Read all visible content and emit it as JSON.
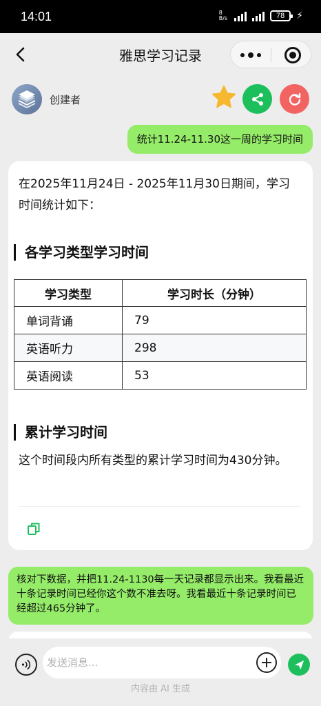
{
  "status": {
    "time": "14:01",
    "speed": "8",
    "speed_unit": "B/s",
    "battery": "78"
  },
  "nav": {
    "title": "雅思学习记录"
  },
  "creator": {
    "label": "创建者"
  },
  "colors": {
    "user_bubble": "#95ec69",
    "share": "#1dbf5c",
    "refresh": "#f26462",
    "star": "#f5b82e"
  },
  "messages": {
    "user_query": "统计11.24-11.30这一周的学习时间",
    "reply": {
      "intro": "在2025年11月24日 - 2025年11月30日期间，学习时间统计如下：",
      "section1_title": "各学习类型学习时间",
      "table": {
        "headers": [
          "学习类型",
          "学习时长（分钟）"
        ],
        "rows": [
          [
            "单词背诵",
            "79"
          ],
          [
            "英语听力",
            "298"
          ],
          [
            "英语阅读",
            "53"
          ]
        ]
      },
      "section2_title": "累计学习时间",
      "summary": "这个时间段内所有类型的累计学习时间为430分钟。"
    },
    "user_followup": "核对下数据，并把11.24-1130每一天记录都显示出来。我看最近十条记录时间已经你这个数不准去呀。我看最近十条记录时间已经超过465分钟了。"
  },
  "input": {
    "placeholder": "发送消息..."
  },
  "footer": {
    "note": "内容由 AI 生成"
  },
  "icons": [
    "back-arrow-icon",
    "more-icon",
    "target-icon",
    "layers-icon",
    "star-icon",
    "share-icon",
    "refresh-icon",
    "copy-icon",
    "voice-icon",
    "plus-icon",
    "send-icon"
  ]
}
